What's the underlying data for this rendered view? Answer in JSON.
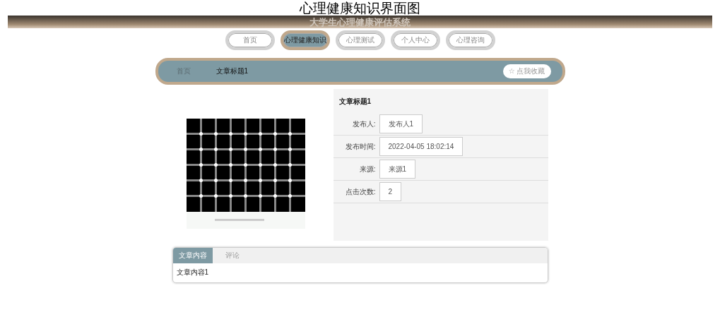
{
  "caption": "心理健康知识界面图",
  "header": {
    "title": "大学生心理健康评估系统"
  },
  "nav": [
    {
      "label": "首页",
      "selected": false
    },
    {
      "label": "心理健康知识",
      "selected": true
    },
    {
      "label": "心理测试",
      "selected": false
    },
    {
      "label": "个人中心",
      "selected": false
    },
    {
      "label": "心理咨询",
      "selected": false
    }
  ],
  "breadcrumb": {
    "items": [
      "首页",
      "文章标题1"
    ],
    "favorite_button": "☆ 点我收藏"
  },
  "article": {
    "title": "文章标题1",
    "fields": [
      {
        "label": "发布人:",
        "value": "发布人1"
      },
      {
        "label": "发布时间:",
        "value": "2022-04-05 18:02:14"
      },
      {
        "label": "来源:",
        "value": "来源1"
      },
      {
        "label": "点击次数:",
        "value": "2"
      }
    ]
  },
  "tabs": [
    {
      "label": "文章内容",
      "selected": true
    },
    {
      "label": "评论",
      "selected": false
    }
  ],
  "content": "文章内容1"
}
